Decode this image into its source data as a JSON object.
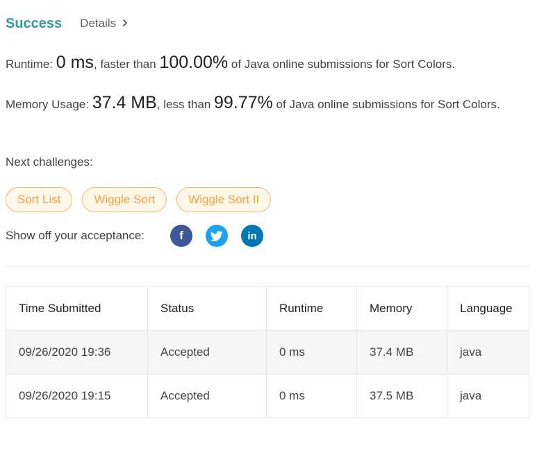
{
  "header": {
    "status": "Success",
    "details_label": "Details"
  },
  "runtime": {
    "prefix": "Runtime: ",
    "value": "0 ms",
    "middle": ", faster than ",
    "percent": "100.00%",
    "suffix": " of Java online submissions for Sort Colors."
  },
  "memory": {
    "prefix": "Memory Usage: ",
    "value": "37.4 MB",
    "middle": ", less than ",
    "percent": "99.77%",
    "suffix": " of Java online submissions for Sort Colors."
  },
  "next_label": "Next challenges:",
  "challenges": [
    "Sort List",
    "Wiggle Sort",
    "Wiggle Sort II"
  ],
  "share_label": "Show off your acceptance:",
  "social": {
    "facebook": "f",
    "linkedin": "in"
  },
  "colors": {
    "success": "#319e8d",
    "chip_border": "#f5b66a",
    "chip_text": "#f4a043",
    "facebook": "#3b5998",
    "twitter": "#1da1f2",
    "linkedin": "#0077b5"
  },
  "table": {
    "headers": [
      "Time Submitted",
      "Status",
      "Runtime",
      "Memory",
      "Language"
    ],
    "rows": [
      [
        "09/26/2020 19:36",
        "Accepted",
        "0 ms",
        "37.4 MB",
        "java"
      ],
      [
        "09/26/2020 19:15",
        "Accepted",
        "0 ms",
        "37.5 MB",
        "java"
      ]
    ]
  }
}
